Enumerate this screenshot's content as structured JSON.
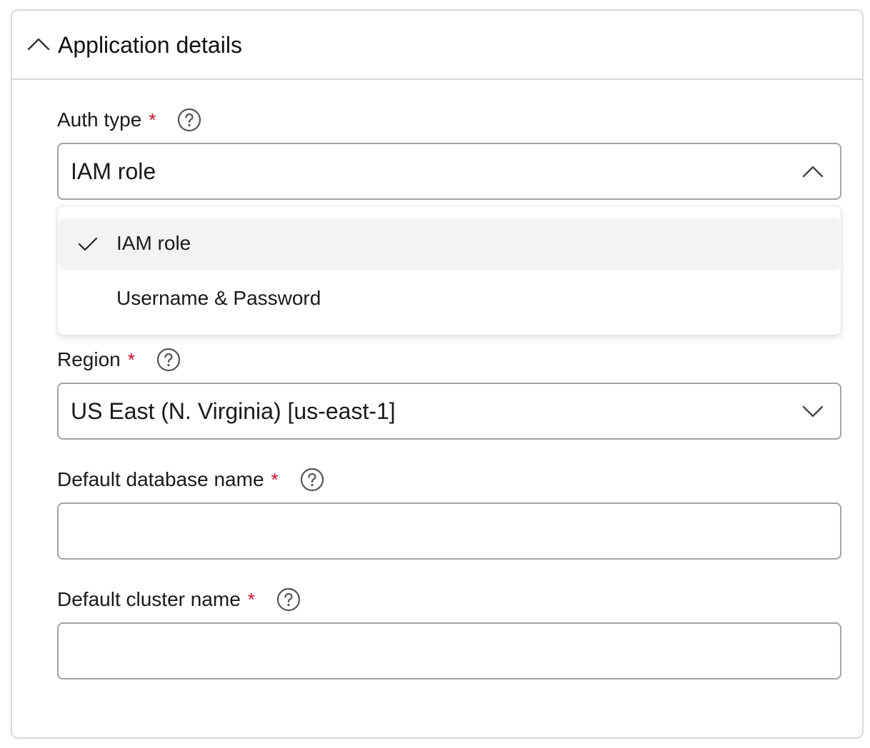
{
  "panel": {
    "title": "Application details"
  },
  "fields": {
    "auth_type": {
      "label": "Auth type",
      "required_mark": "*",
      "selected_value": "IAM role",
      "options": [
        "IAM role",
        "Username & Password"
      ]
    },
    "region": {
      "label": "Region",
      "required_mark": "*",
      "selected_value": "US East (N. Virginia) [us-east-1]"
    },
    "default_database_name": {
      "label": "Default database name",
      "required_mark": "*",
      "value": ""
    },
    "default_cluster_name": {
      "label": "Default cluster name",
      "required_mark": "*",
      "value": ""
    }
  },
  "colors": {
    "required_star": "#c8102e",
    "border": "#a3a3a3",
    "selected_option_bg": "#f3f3f3"
  },
  "icons": {
    "collapse": "chevron-up-icon",
    "help": "help-circle-icon",
    "select_open": "chevron-up-icon",
    "select_closed": "chevron-down-icon",
    "selected_option": "check-icon"
  }
}
